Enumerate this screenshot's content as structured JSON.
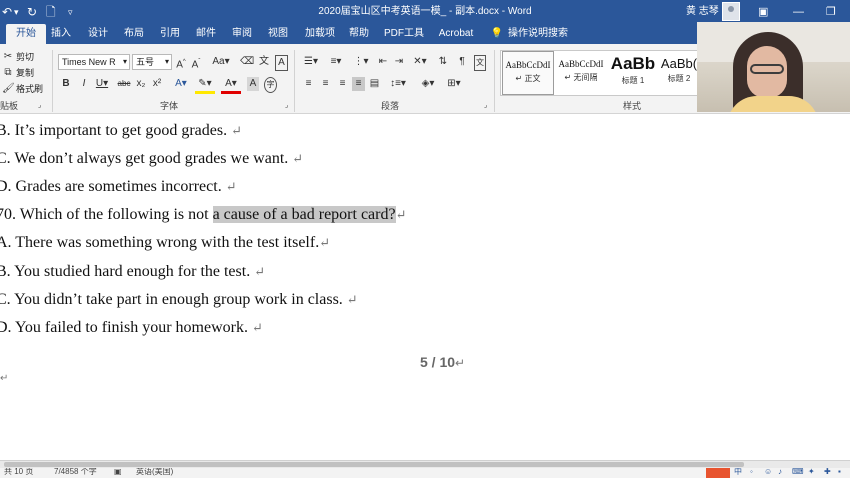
{
  "titlebar": {
    "doc_title": "2020届宝山区中考英语一模_ - 副本.docx  -  Word",
    "user_name": "黄 志琴",
    "undo_icon": "undo-icon",
    "redo_icon": "redo-icon",
    "new_doc_icon": "new-document-icon",
    "customize_icon": "customize-qat-icon"
  },
  "tabs": [
    "开始",
    "插入",
    "设计",
    "布局",
    "引用",
    "邮件",
    "审阅",
    "视图",
    "加载项",
    "帮助",
    "PDF工具",
    "Acrobat"
  ],
  "tell_me": "操作说明搜索",
  "ribbon": {
    "clipboard": {
      "cut": "剪切",
      "copy": "复制",
      "format_painter": "格式刷",
      "label": "贴板"
    },
    "font": {
      "name": "Times New R",
      "size": "五号",
      "label": "字体"
    },
    "paragraph": {
      "label": "段落"
    },
    "styles": {
      "label": "样式",
      "items": [
        {
          "preview": "AaBbCcDdI",
          "name": "↵ 正文"
        },
        {
          "preview": "AaBbCcDdI",
          "name": "↵ 无间隔"
        },
        {
          "preview": "AaBb",
          "name": "标题 1"
        },
        {
          "preview": "AaBb(",
          "name": "标题 2"
        }
      ]
    }
  },
  "document": {
    "lines": [
      "B. It’s important to get good grades.",
      "C. We don’t always get good grades we want.",
      "D. Grades are sometimes incorrect.",
      "70. Which of the following is not ",
      "A. There was something wrong with the test itself.",
      "B. You studied hard enough for the test.",
      "C. You didn’t take part in enough group work in class.",
      "D. You failed to finish your homework."
    ],
    "highlight": "a cause of a bad report card?",
    "page_number": "5  /  10",
    "paragraph_mark": "↵"
  },
  "statusbar": {
    "page_info": "共 10 页",
    "word_count": "7/4858 个字",
    "language": "英语(美国)",
    "ime_label": "中"
  }
}
